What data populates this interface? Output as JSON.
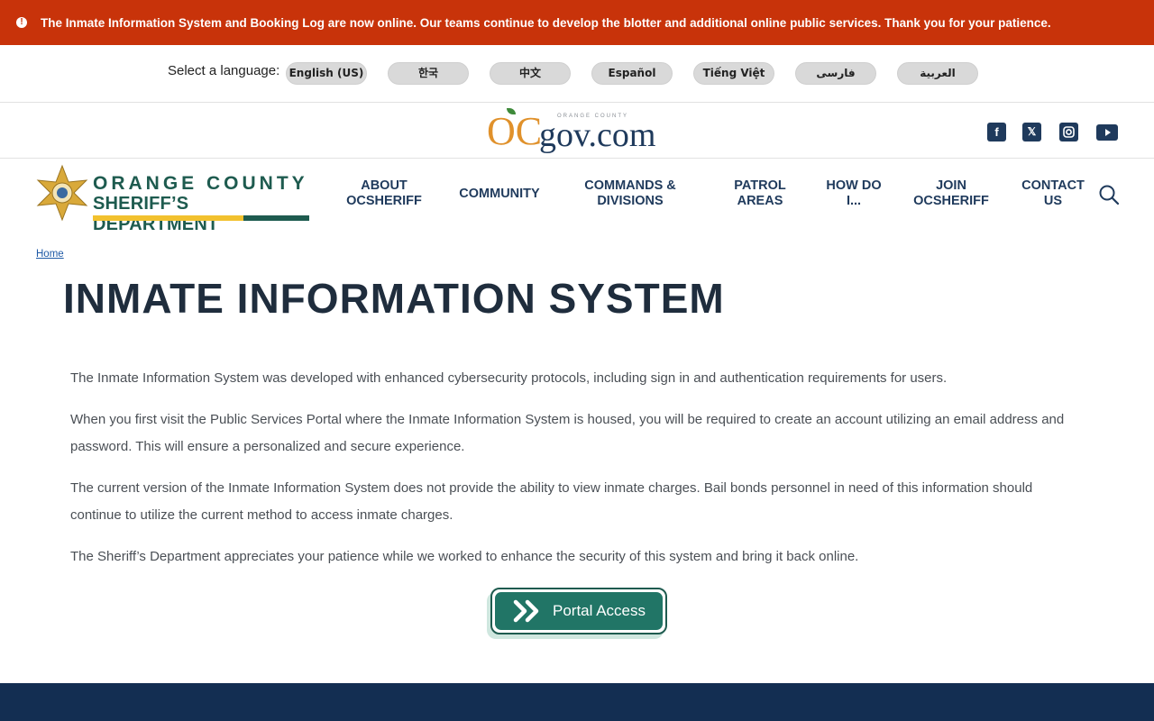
{
  "alert": {
    "icon": "alert-circle-icon",
    "text": "The Inmate Information System and Booking Log are now online. Our teams continue to develop the blotter and additional online public services. Thank you for your patience."
  },
  "language": {
    "label": "Select a language:",
    "options": [
      "English (US)",
      "한국",
      "中文",
      "Español",
      "Tiếng Việt",
      "فارسی",
      "العربية"
    ]
  },
  "ocgov": {
    "small": "ORANGE COUNTY",
    "oc": "OC",
    "gov": "gov.com"
  },
  "social": [
    "facebook-icon",
    "x-icon",
    "instagram-icon",
    "youtube-icon"
  ],
  "brand": {
    "line1": "ORANGE COUNTY",
    "line2": "SHERIFF’S DEPARTMENT"
  },
  "nav": {
    "items": [
      {
        "line1": "ABOUT",
        "line2": "OCSHERIFF"
      },
      {
        "line1": "COMMUNITY",
        "line2": ""
      },
      {
        "line1": "COMMANDS &",
        "line2": "DIVISIONS"
      },
      {
        "line1": "PATROL",
        "line2": "AREAS"
      },
      {
        "line1": "HOW DO",
        "line2": "I..."
      },
      {
        "line1": "JOIN",
        "line2": "OCSHERIFF"
      },
      {
        "line1": "CONTACT",
        "line2": "US"
      }
    ]
  },
  "breadcrumb": "Home",
  "page_title": "INMATE INFORMATION SYSTEM",
  "paragraphs": [
    "The Inmate Information System was  developed with enhanced cybersecurity protocols, including sign in and authentication requirements for users.",
    "When you first visit the Public Services Portal where the Inmate Information System is housed, you will be required to create an account utilizing an email address and password. This will ensure a personalized and secure experience.",
    "The current version of the Inmate Information System does not provide the ability to view inmate charges. Bail bonds personnel in need of this information should continue to utilize the current method to access inmate charges.",
    "The Sheriff’s Department appreciates your patience while we worked to enhance the security of this system and bring it back online."
  ],
  "portal_button": "Portal Access",
  "colors": {
    "alert": "#c8330a",
    "brand_green": "#1e5b4f",
    "brand_gold": "#f2c12e",
    "navy": "#1f3a5c",
    "footer": "#132e52",
    "portal": "#217566"
  }
}
